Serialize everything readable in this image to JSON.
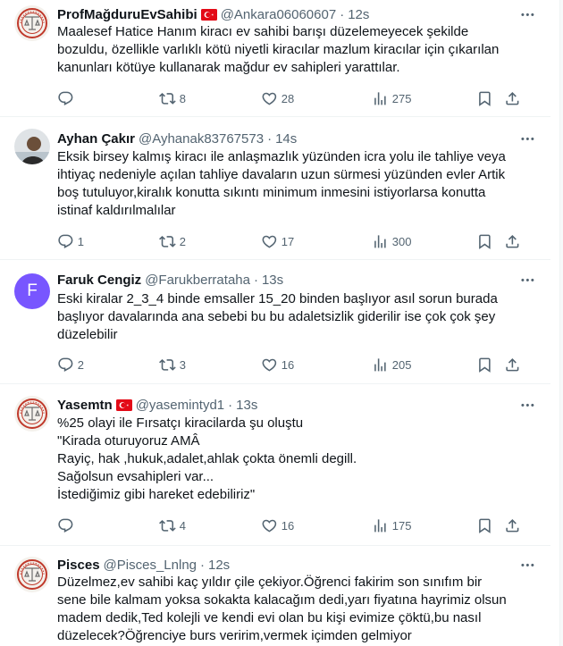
{
  "tweets": [
    {
      "name": "ProfMağduruEvSahibi",
      "handle": "@Ankara06060607",
      "dot": "·",
      "time": "12s",
      "lines": [
        "Maalesef Hatice Hanım  kiracı ev sahibi barışı düzelemeyecek şekilde",
        "bozuldu, özellikle varlıklı kötü niyetli kiracılar mazlum kiracılar için çıkarılan",
        "kanunları kötüye kullanarak mağdur ev sahipleri yarattılar."
      ],
      "replies": "",
      "retweets": "8",
      "likes": "28",
      "views": "275"
    },
    {
      "name": "Ayhan Çakır",
      "handle": "@Ayhanak83767573",
      "dot": "·",
      "time": "14s",
      "lines": [
        "Eksik birsey kalmış kiracı ile anlaşmazlık yüzünden icra yolu ile tahliye veya",
        "ihtiyaç nedeniyle açılan tahliye davaların uzun sürmesi yüzünden evler Artik",
        "boş tutuluyor,kiralık konutta sıkıntı minimum inmesini istiyorlarsa konutta",
        "istinaf kaldırılmalılar"
      ],
      "replies": "1",
      "retweets": "2",
      "likes": "17",
      "views": "300"
    },
    {
      "name": "Faruk Cengiz",
      "handle": "@Farukberrataha",
      "dot": "·",
      "time": "13s",
      "avatar_letter": "F",
      "lines": [
        "Eski kiralar 2_3_4 binde emsaller 15_20 binden başlıyor asıl sorun burada",
        "başlıyor davalarında ana sebebi bu bu adaletsizlik giderilir ise çok çok şey",
        "düzelebilir"
      ],
      "replies": "2",
      "retweets": "3",
      "likes": "16",
      "views": "205"
    },
    {
      "name": "Yasemtn",
      "handle": "@yasemintyd1",
      "dot": "·",
      "time": "13s",
      "lines": [
        "%25 olayi ile Fırsatçı kiracilarda şu oluştu",
        "\"Kirada oturuyoruz AMÂ",
        "Rayiç, hak ,hukuk,adalet,ahlak çokta önemli degill.",
        "Sağolsun evsahipleri var...",
        "İstediğimiz gibi hareket edebiliriz\""
      ],
      "replies": "",
      "retweets": "4",
      "likes": "16",
      "views": "175"
    },
    {
      "name": "Pisces",
      "handle": "@Pisces_Lnlng",
      "dot": "·",
      "time": "12s",
      "lines": [
        "Düzelmez,ev sahibi kaç yıldır çile çekiyor.Öğrenci fakirim son sınıfım bir",
        "sene bile kalmam yoksa sokakta kalacağım dedi,yarı fiyatına hayrimiz olsun",
        "madem dedik,Ted kolejli ve kendi evi olan bu kişi evimize çöktü,bu nasıl",
        "düzelecek?Öğrenciye burs veririm,vermek içimden gelmiyor"
      ],
      "replies": "",
      "retweets": "",
      "likes": "",
      "views": ""
    }
  ],
  "colors": {
    "text": "#0f1419",
    "muted": "#536471",
    "divider": "#eff3f4",
    "avatar_letter_bg": "#7856ff",
    "flag_red": "#e30a17"
  },
  "icons": [
    "more-icon",
    "reply-icon",
    "retweet-icon",
    "like-icon",
    "views-icon",
    "bookmark-icon",
    "share-icon",
    "turkey-flag-icon"
  ]
}
